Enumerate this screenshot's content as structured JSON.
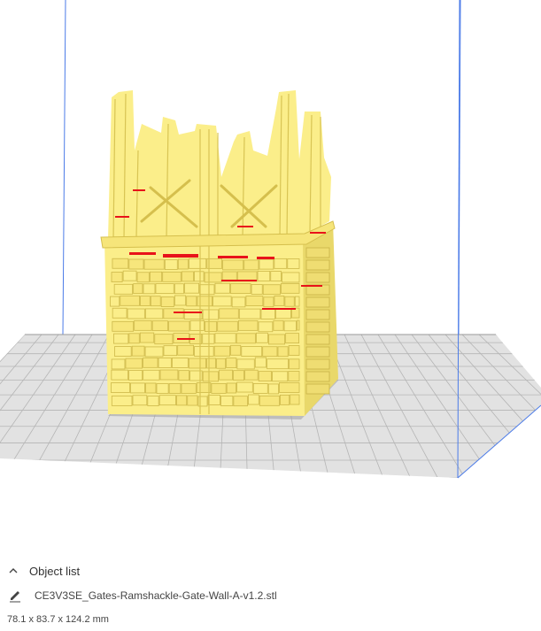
{
  "colors": {
    "model_fill": "#fbee8a",
    "model_shadow": "#e7d665",
    "overhang": "#e8131a",
    "build_volume_edge": "#4b7be8",
    "build_plate": "#dcdcdc",
    "grid_line": "#b9b9b9"
  },
  "object_panel": {
    "toggle_icon": "chevron-up-icon",
    "title": "Object list",
    "edit_icon": "pencil-icon",
    "file_name": "CE3V3SE_Gates-Ramshackle-Gate-Wall-A-v1.2.stl",
    "dimensions": "78.1 x 83.7 x 124.2 mm"
  }
}
